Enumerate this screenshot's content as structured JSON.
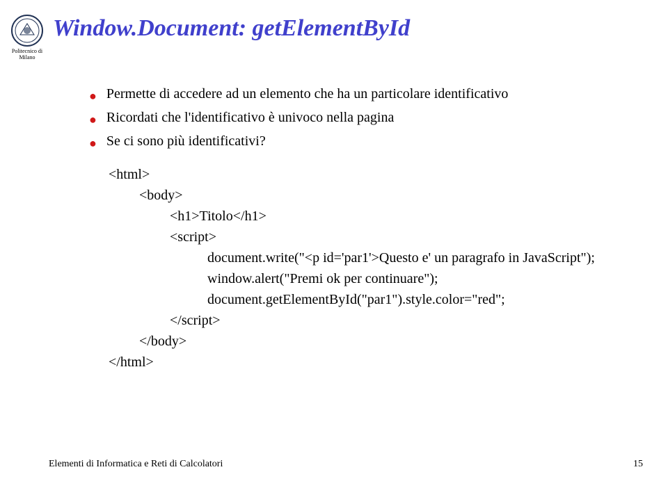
{
  "university": {
    "line1": "Politecnico di",
    "line2": "Milano"
  },
  "title": "Window.Document: getElementById",
  "bullets": [
    "Permette di accedere ad un elemento che ha un particolare identificativo",
    "Ricordati che l'identificativo è univoco nella pagina",
    "Se ci sono più identificativi?"
  ],
  "code": {
    "l1": "<html>",
    "l2": "<body>",
    "l3": "<h1>Titolo</h1>",
    "l4": "<script>",
    "l5": "document.write(\"<p id='par1'>Questo e' un paragrafo in JavaScript\");",
    "l6": "window.alert(\"Premi ok per  continuare\");",
    "l7": "document.getElementById(\"par1\").style.color=\"red\";",
    "l8": "</script>",
    "l9": "</body>",
    "l10": "</html>"
  },
  "footer": {
    "left": "Elementi di Informatica e Reti di Calcolatori",
    "right": "15"
  }
}
